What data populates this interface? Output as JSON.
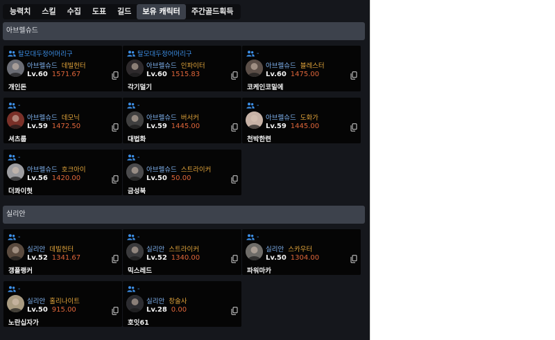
{
  "tabs": [
    "능력치",
    "스킬",
    "수집",
    "도표",
    "길드",
    "보유 캐릭터",
    "주간골드획득"
  ],
  "active_tab": 5,
  "sections": [
    {
      "title": "아브렐슈드",
      "cards": [
        {
          "guild": "탈모대두정어머리구",
          "server": "아브렐슈드",
          "class": "데빌헌터",
          "level": "Lv.60",
          "item_level": "1571.67",
          "name": "개인돈",
          "avatar": "#6b6d75"
        },
        {
          "guild": "탈모대두정어머리구",
          "server": "아브렐슈드",
          "class": "인파이터",
          "level": "Lv.60",
          "item_level": "1515.83",
          "name": "각기덜기",
          "avatar": "#2e2a2c"
        },
        {
          "guild": "-",
          "server": "아브렐슈드",
          "class": "블레스터",
          "level": "Lv.60",
          "item_level": "1475.00",
          "name": "코케인코밑에",
          "avatar": "#5c4f48"
        },
        {
          "guild": "-",
          "server": "아브렐슈드",
          "class": "데모닉",
          "level": "Lv.59",
          "item_level": "1472.50",
          "name": "셔츠룹",
          "avatar": "#7a3028"
        },
        {
          "guild": "-",
          "server": "아브렐슈드",
          "class": "버서커",
          "level": "Lv.59",
          "item_level": "1445.00",
          "name": "대법화",
          "avatar": "#3f3f3f"
        },
        {
          "guild": "-",
          "server": "아브렐슈드",
          "class": "도화가",
          "level": "Lv.59",
          "item_level": "1445.00",
          "name": "천박한련",
          "avatar": "#c7b2a6"
        },
        {
          "guild": "-",
          "server": "아브렐슈드",
          "class": "호크아이",
          "level": "Lv.56",
          "item_level": "1420.00",
          "name": "더콰이헛",
          "avatar": "#9c9ca0"
        },
        {
          "guild": "-",
          "server": "아브렐슈드",
          "class": "스트라이커",
          "level": "Lv.50",
          "item_level": "50.00",
          "name": "금성북",
          "avatar": "#4a4a4c"
        }
      ]
    },
    {
      "title": "실리안",
      "cards": [
        {
          "guild": "-",
          "server": "실리안",
          "class": "데빌헌터",
          "level": "Lv.52",
          "item_level": "1341.67",
          "name": "갱플랭커",
          "avatar": "#5a4a3e"
        },
        {
          "guild": "-",
          "server": "실리안",
          "class": "스트라이커",
          "level": "Lv.52",
          "item_level": "1340.00",
          "name": "믹스레드",
          "avatar": "#3a3a3c"
        },
        {
          "guild": "-",
          "server": "실리안",
          "class": "스카우터",
          "level": "Lv.50",
          "item_level": "1304.00",
          "name": "파워마카",
          "avatar": "#6e6c68"
        },
        {
          "guild": "-",
          "server": "실리안",
          "class": "홀리나이트",
          "level": "Lv.50",
          "item_level": "915.00",
          "name": "노란십자가",
          "avatar": "#a89a80"
        },
        {
          "guild": "-",
          "server": "실리안",
          "class": "창술사",
          "level": "Lv.28",
          "item_level": "0.00",
          "name": "호잇61",
          "avatar": "#2c2c30"
        }
      ]
    }
  ]
}
